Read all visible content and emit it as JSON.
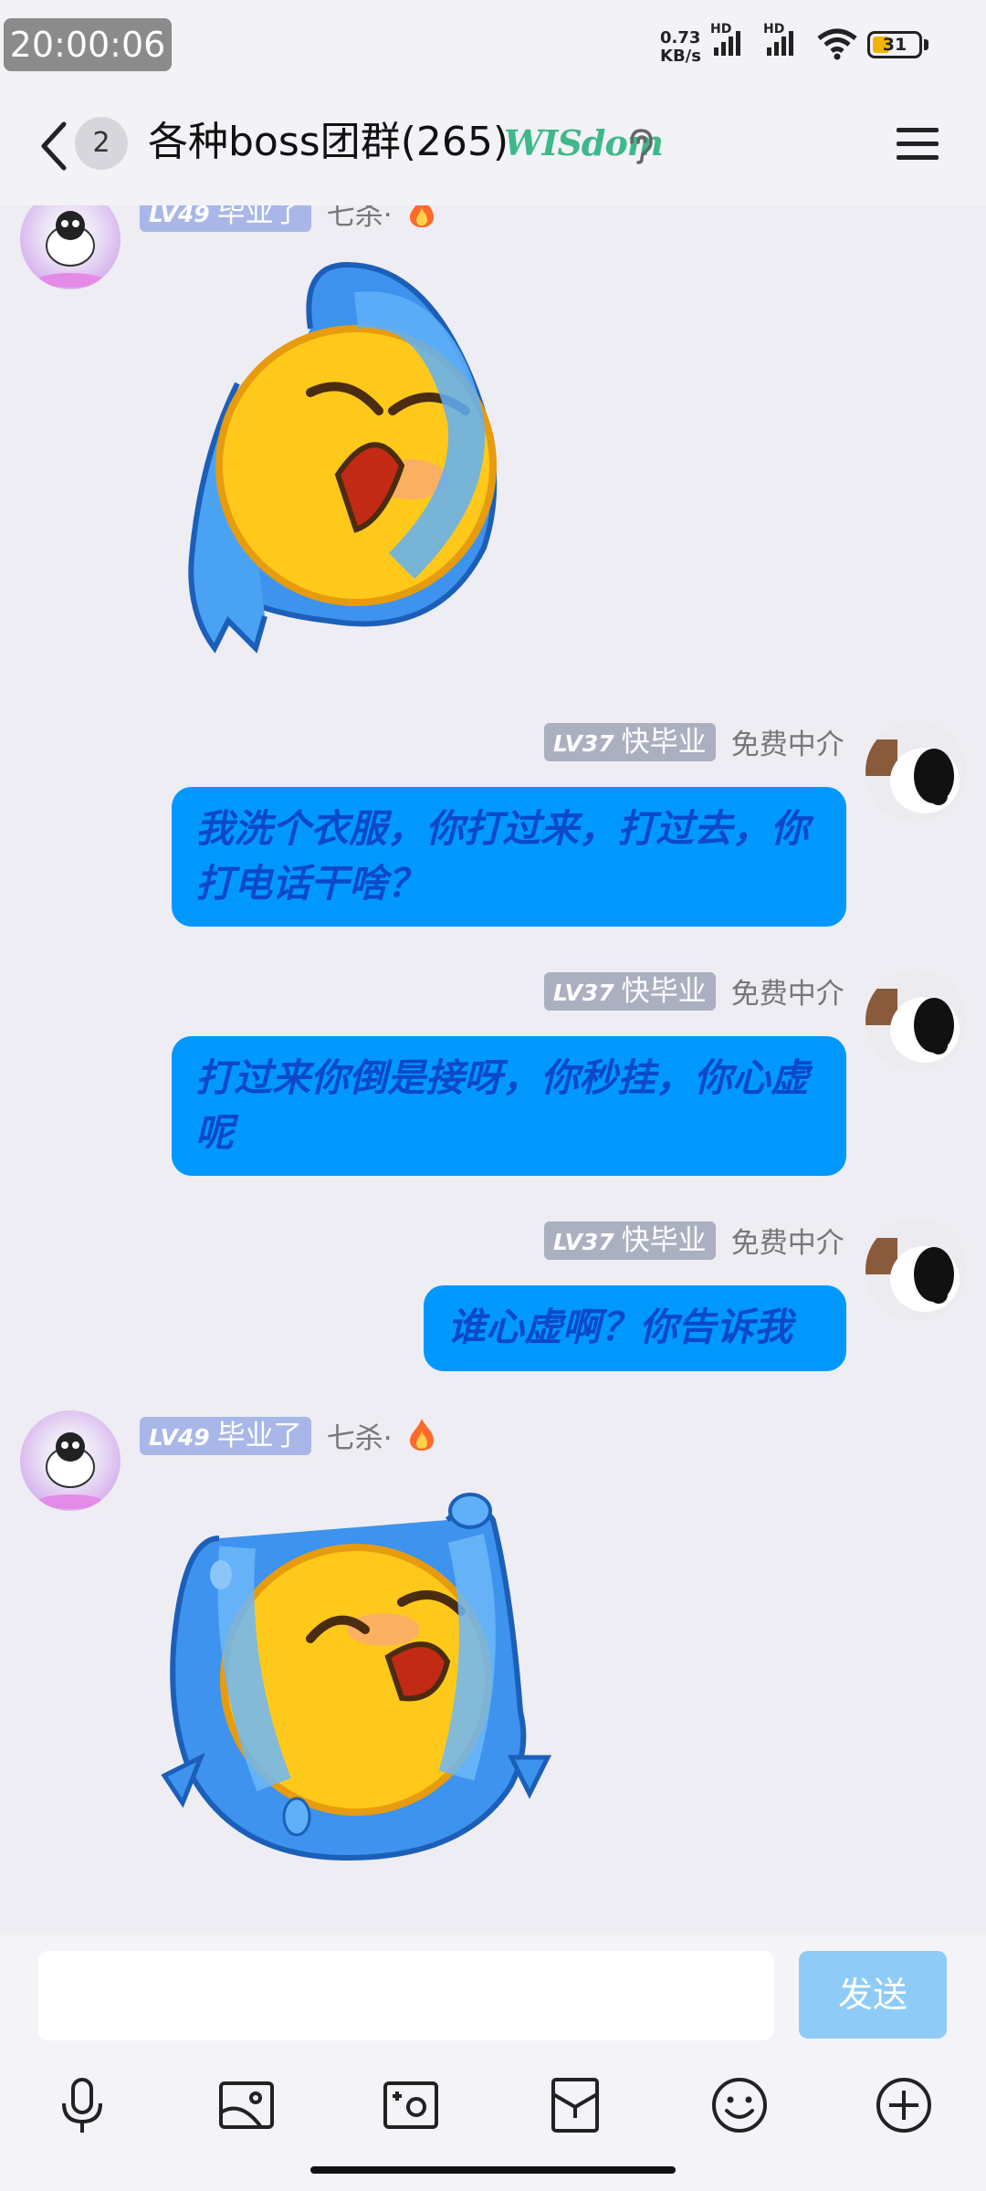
{
  "status_bar": {
    "time": "20:00:06",
    "net_speed_value": "0.73",
    "net_speed_unit": "KB/s",
    "hd_1": "HD",
    "hd_2": "HD",
    "battery": "31"
  },
  "header": {
    "unread_count": "2",
    "title": "各种boss团群(265)",
    "badge": "WISdom"
  },
  "messages": [
    {
      "side": "left",
      "level": "LV49",
      "badge": "毕业了",
      "nickname": "七杀·",
      "type": "sticker",
      "sticker": "crying-face-sticker"
    },
    {
      "side": "right",
      "level": "LV37",
      "badge": "快毕业",
      "nickname": "免费中介",
      "type": "text",
      "text": "我洗个衣服，你打过来，打过去，你打电话干啥？"
    },
    {
      "side": "right",
      "level": "LV37",
      "badge": "快毕业",
      "nickname": "免费中介",
      "type": "text",
      "text": "打过来你倒是接呀，你秒挂，你心虚呢"
    },
    {
      "side": "right",
      "level": "LV37",
      "badge": "快毕业",
      "nickname": "免费中介",
      "type": "text",
      "text": "谁心虚啊？你告诉我"
    },
    {
      "side": "left",
      "level": "LV49",
      "badge": "毕业了",
      "nickname": "七杀·",
      "type": "sticker",
      "sticker": "wailing-face-sticker"
    }
  ],
  "input": {
    "placeholder": "",
    "send_label": "发送"
  },
  "toolbar": [
    "microphone-icon",
    "image-icon",
    "camera-icon",
    "red-packet-icon",
    "emoji-icon",
    "plus-icon"
  ],
  "colors": {
    "bubble": "#0098ff",
    "bubble_text": "#0b49c9",
    "send_disabled": "#8fcbf7"
  }
}
